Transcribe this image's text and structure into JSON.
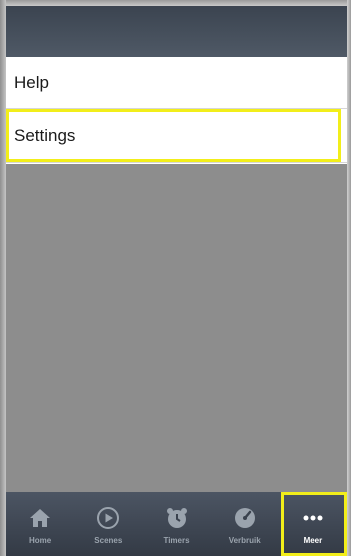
{
  "menu": {
    "items": [
      {
        "label": "Help"
      },
      {
        "label": "Settings"
      }
    ]
  },
  "tabbar": {
    "tabs": [
      {
        "label": "Home",
        "icon": "home-icon"
      },
      {
        "label": "Scenes",
        "icon": "play-icon"
      },
      {
        "label": "Timers",
        "icon": "alarm-clock-icon"
      },
      {
        "label": "Verbruik",
        "icon": "gauge-icon"
      },
      {
        "label": "Meer",
        "icon": "more-dots-icon"
      }
    ]
  },
  "colors": {
    "highlight": "#f2ee1a",
    "titlebar": "#4a5360",
    "content_bg": "#8d8d8d"
  }
}
